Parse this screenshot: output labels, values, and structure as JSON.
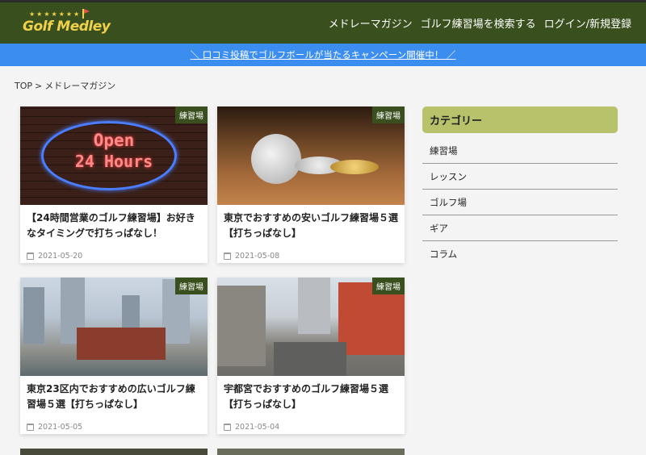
{
  "header": {
    "logo_text": "Golf Medley",
    "nav": [
      "メドレーマガジン",
      "ゴルフ練習場を検索する",
      "ログイン/新規登録"
    ]
  },
  "banner": {
    "text": "＼ 口コミ投稿でゴルフボールが当たるキャンペーン開催中！ ／"
  },
  "breadcrumb": {
    "home": "TOP",
    "separator": ">",
    "current": "メドレーマガジン"
  },
  "articles": [
    {
      "category": "練習場",
      "title": "【24時間営業のゴルフ練習場】お好きなタイミングで打ちっぱなし！",
      "date": "2021-05-20",
      "image_text_1": "Open",
      "image_text_2": "24 Hours"
    },
    {
      "category": "練習場",
      "title": "東京でおすすめの安いゴルフ練習場５選【打ちっぱなし】",
      "date": "2021-05-08"
    },
    {
      "category": "練習場",
      "title": "東京23区内でおすすめの広いゴルフ練習場５選【打ちっぱなし】",
      "date": "2021-05-05"
    },
    {
      "category": "練習場",
      "title": "宇都宮でおすすめのゴルフ練習場５選【打ちっぱなし】",
      "date": "2021-05-04"
    }
  ],
  "sidebar": {
    "heading": "カテゴリー",
    "items": [
      "練習場",
      "レッスン",
      "ゴルフ場",
      "ギア",
      "コラム"
    ]
  },
  "colors": {
    "header_bg": "#3a4f1e",
    "banner_bg": "#3b8df0",
    "sidebar_head_bg": "#b7c26a",
    "logo": "#f0d24a"
  }
}
